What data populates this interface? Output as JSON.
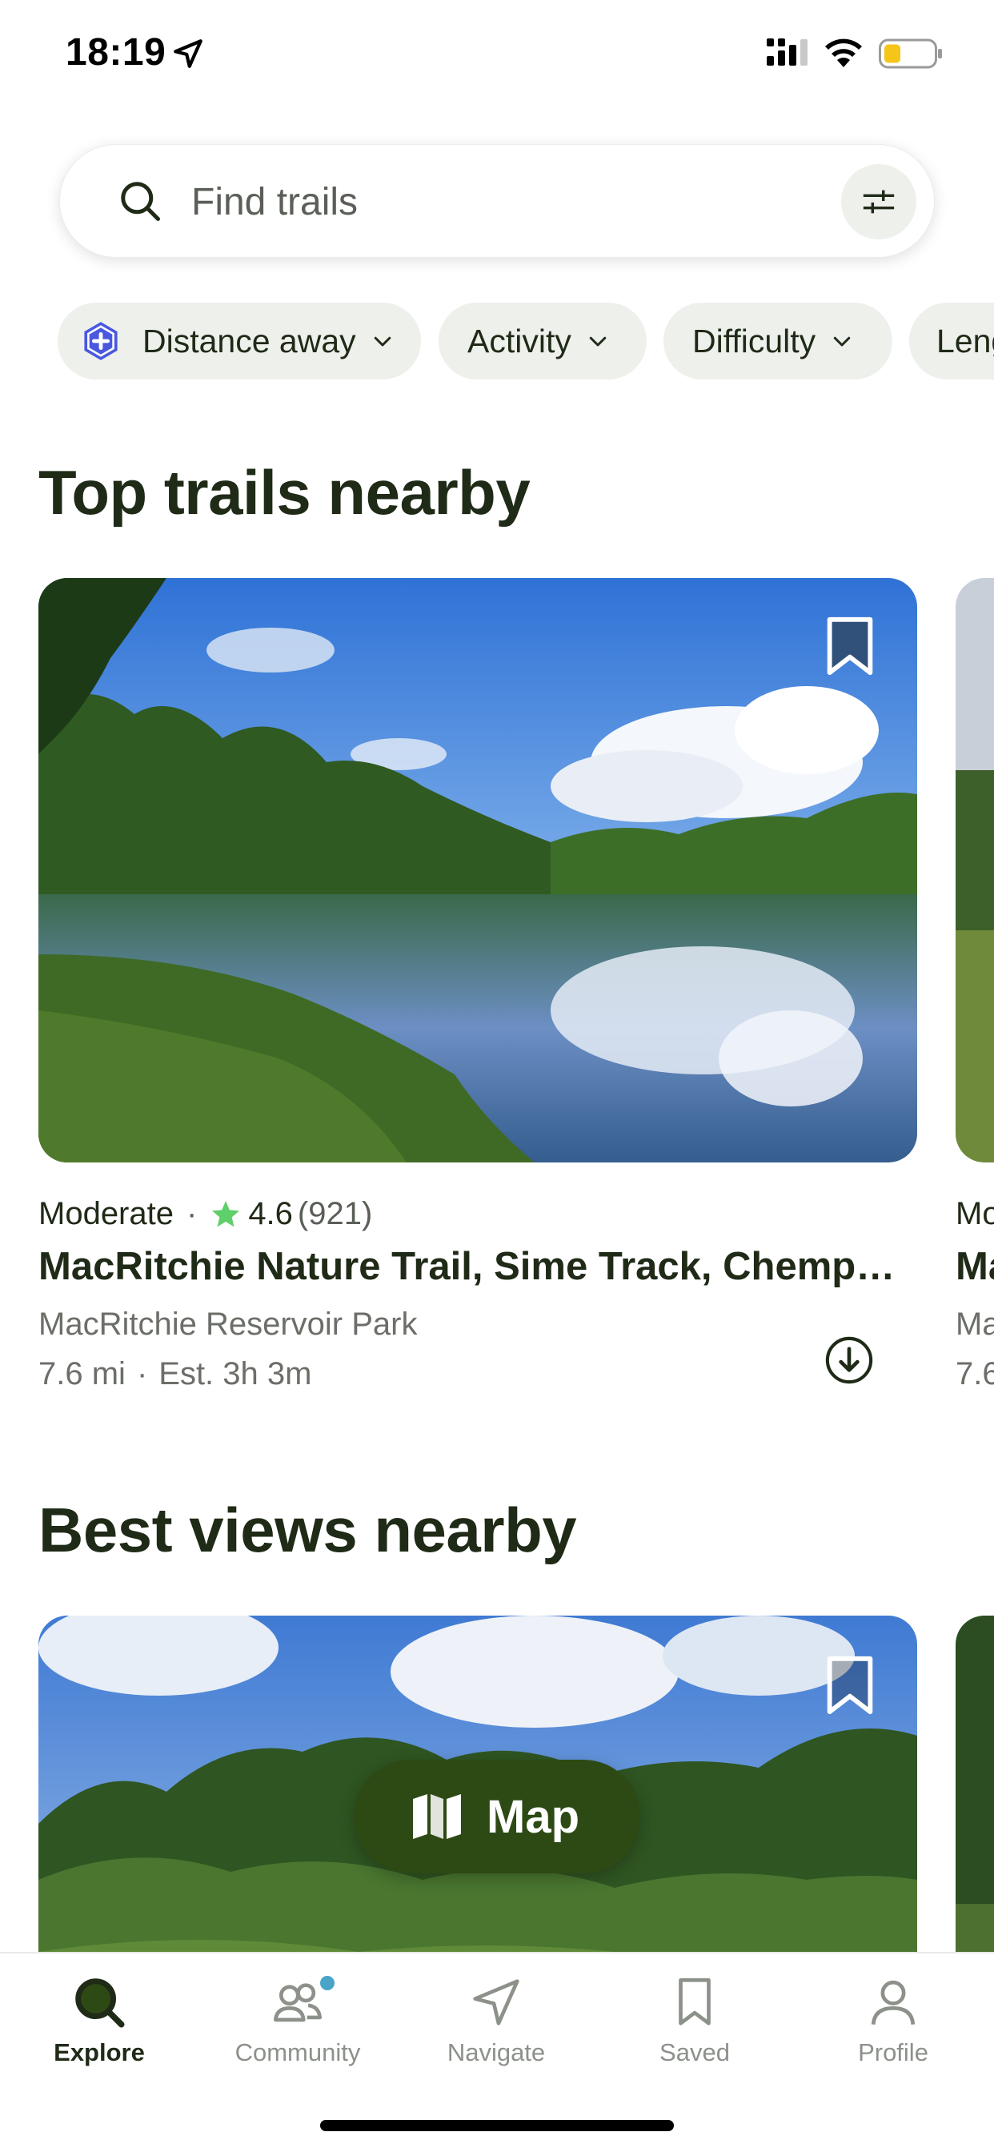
{
  "status_bar": {
    "time": "18:19",
    "icons": [
      "location-arrow-icon",
      "cellular-icon",
      "wifi-icon",
      "battery-icon"
    ],
    "battery_color": "#f5c518"
  },
  "search": {
    "placeholder": "Find trails",
    "value": ""
  },
  "filters": {
    "chips": [
      "Distance away",
      "Activity",
      "Difficulty",
      "Length"
    ],
    "active_chip_badge_color": "#4a58e0"
  },
  "sections": {
    "top_trails": {
      "title": "Top trails nearby",
      "card": {
        "difficulty": "Moderate",
        "rating": "4.6",
        "review_count": "(921)",
        "name": "MacRitchie Nature Trail, Sime Track, Chempa…",
        "park": "MacRitchie Reservoir Park",
        "distance": "7.6 mi",
        "est_time": "Est. 3h 3m"
      },
      "peek_card": {
        "meta": "Mo",
        "name": "Ma",
        "park": "Ma",
        "stats": "7.6"
      }
    },
    "best_views": {
      "title": "Best views nearby"
    }
  },
  "map_button": {
    "label": "Map"
  },
  "tab_bar": {
    "tabs": [
      {
        "label": "Explore",
        "active": true
      },
      {
        "label": "Community",
        "active": false
      },
      {
        "label": "Navigate",
        "active": false
      },
      {
        "label": "Saved",
        "active": false
      },
      {
        "label": "Profile",
        "active": false
      }
    ]
  },
  "colors": {
    "brand_dark_green": "#2e4a14",
    "text_primary": "#1f2a17",
    "star_green": "#5fcf6a",
    "chip_bg": "#eef0ec"
  }
}
